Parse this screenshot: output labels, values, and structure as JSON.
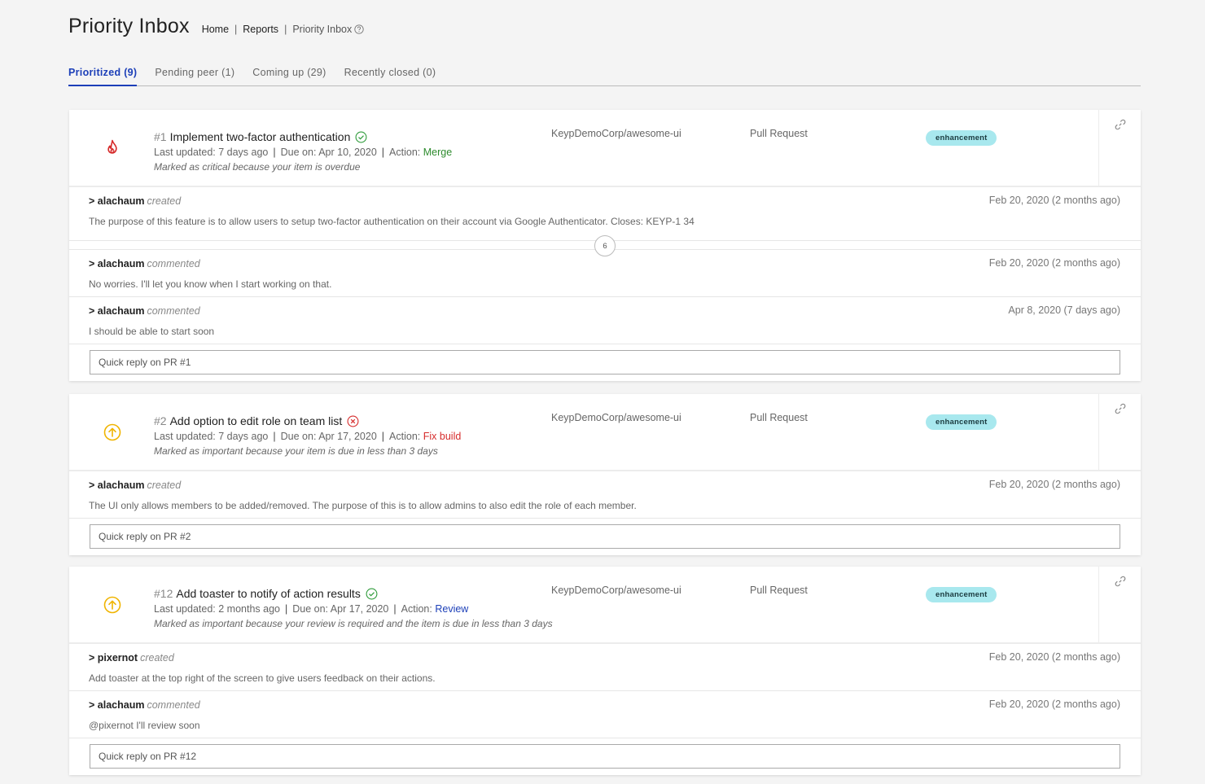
{
  "header": {
    "title": "Priority Inbox",
    "breadcrumb": {
      "home": "Home",
      "reports": "Reports",
      "current": "Priority Inbox",
      "sep": "|"
    }
  },
  "tabs": [
    {
      "label": "Prioritized (9)"
    },
    {
      "label": "Pending peer (1)"
    },
    {
      "label": "Coming up (29)"
    },
    {
      "label": "Recently closed (0)"
    }
  ],
  "items": [
    {
      "number": "#1",
      "title": "Implement two-factor authentication",
      "status_icon": "check-circle-icon",
      "priority_icon": "fire-icon",
      "last_updated": "Last updated: 7 days ago",
      "due": "Due on: Apr 10, 2020",
      "action_label": "Action:",
      "action": "Merge",
      "reason": "Marked as critical because your item is overdue",
      "repo": "KeypDemoCorp/awesome-ui",
      "type": "Pull Request",
      "label": "enhancement",
      "events": [
        {
          "user": "> alachaum",
          "verb": "created",
          "date": "Feb 20, 2020 (2 months ago)",
          "body": "The purpose of this feature is to allow users to setup two-factor authentication on their account via Google Authenticator. Closes: KEYP-1 34"
        }
      ],
      "collapsed_count": "6",
      "later_events": [
        {
          "user": "> alachaum",
          "verb": "commented",
          "date": "Feb 20, 2020 (2 months ago)",
          "body": "No worries. I'll let you know when I start working on that."
        },
        {
          "user": "> alachaum",
          "verb": "commented",
          "date": "Apr 8, 2020 (7 days ago)",
          "body": "I should be able to start soon"
        }
      ],
      "reply_placeholder": "Quick reply on PR #1"
    },
    {
      "number": "#2",
      "title": "Add option to edit role on team list",
      "status_icon": "x-circle-icon",
      "priority_icon": "arrow-up-circle-icon",
      "last_updated": "Last updated: 7 days ago",
      "due": "Due on: Apr 17, 2020",
      "action_label": "Action:",
      "action": "Fix build",
      "reason": "Marked as important because your item is due in less than 3 days",
      "repo": "KeypDemoCorp/awesome-ui",
      "type": "Pull Request",
      "label": "enhancement",
      "events": [
        {
          "user": "> alachaum",
          "verb": "created",
          "date": "Feb 20, 2020 (2 months ago)",
          "body": "The UI only allows members to be added/removed. The purpose of this is to allow admins to also edit the role of each member."
        }
      ],
      "reply_placeholder": "Quick reply on PR #2"
    },
    {
      "number": "#12",
      "title": "Add toaster to notify of action results",
      "status_icon": "check-circle-icon",
      "priority_icon": "arrow-up-circle-icon",
      "last_updated": "Last updated: 2 months ago",
      "due": "Due on: Apr 17, 2020",
      "action_label": "Action:",
      "action": "Review",
      "reason": "Marked as important because your review is required and the item is due in less than 3 days",
      "repo": "KeypDemoCorp/awesome-ui",
      "type": "Pull Request",
      "label": "enhancement",
      "events": [
        {
          "user": "> pixernot",
          "verb": "created",
          "date": "Feb 20, 2020 (2 months ago)",
          "body": "Add toaster at the top right of the screen to give users feedback on their actions."
        },
        {
          "user": "> alachaum",
          "verb": "commented",
          "date": "Feb 20, 2020 (2 months ago)",
          "body": "@pixernot I'll review soon"
        }
      ],
      "reply_placeholder": "Quick reply on PR #12"
    }
  ],
  "colors": {
    "accent": "#1c3fb8",
    "critical": "#d62c2c",
    "important": "#f0b400",
    "success": "#2e8b2e",
    "label_bg": "#a8e8ee"
  }
}
